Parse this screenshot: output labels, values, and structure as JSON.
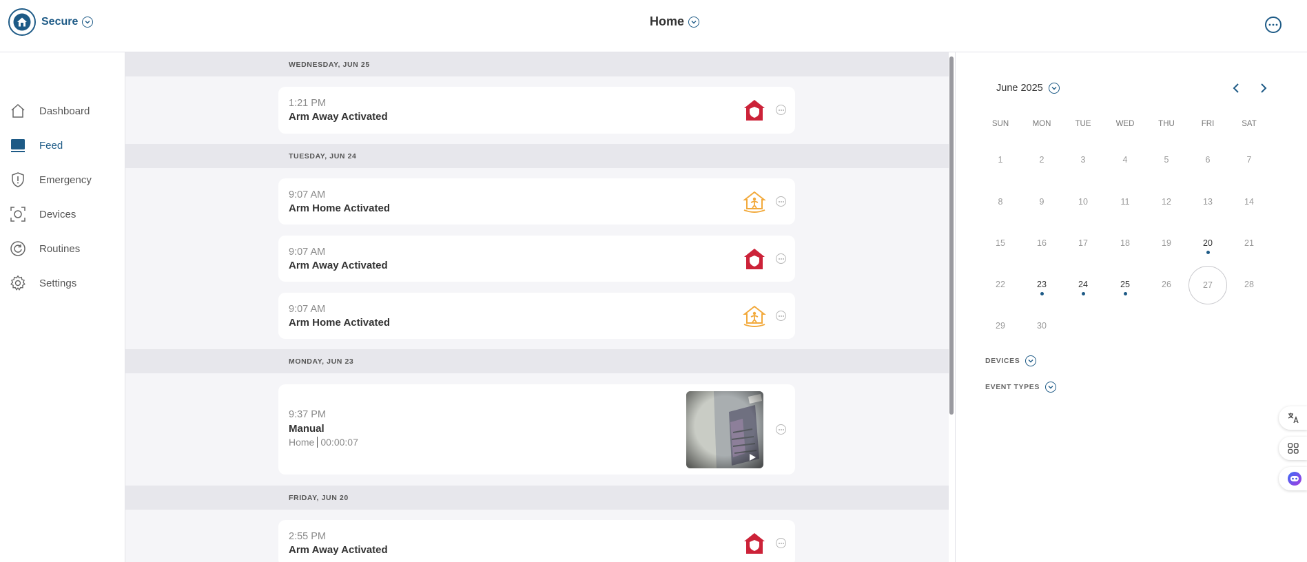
{
  "header": {
    "brand_label": "Secure",
    "title": "Home"
  },
  "sidebar": {
    "items": [
      {
        "label": "Dashboard",
        "icon": "home-outline-icon"
      },
      {
        "label": "Feed",
        "icon": "feed-icon"
      },
      {
        "label": "Emergency",
        "icon": "shield-alert-icon"
      },
      {
        "label": "Devices",
        "icon": "camera-device-icon"
      },
      {
        "label": "Routines",
        "icon": "routine-refresh-icon"
      },
      {
        "label": "Settings",
        "icon": "gear-icon"
      }
    ],
    "active": "Feed"
  },
  "feed": {
    "days": [
      {
        "header": "WEDNESDAY, JUN 25",
        "events": [
          {
            "time": "1:21 PM",
            "title": "Arm Away Activated",
            "icon": "arm-away-icon"
          }
        ]
      },
      {
        "header": "TUESDAY, JUN 24",
        "events": [
          {
            "time": "9:07 AM",
            "title": "Arm Home Activated",
            "icon": "arm-home-icon"
          },
          {
            "time": "9:07 AM",
            "title": "Arm Away Activated",
            "icon": "arm-away-icon"
          },
          {
            "time": "9:07 AM",
            "title": "Arm Home Activated",
            "icon": "arm-home-icon"
          }
        ]
      },
      {
        "header": "MONDAY, JUN 23",
        "events": [
          {
            "time": "9:37 PM",
            "title": "Manual",
            "location": "Home",
            "duration": "00:00:07",
            "icon": "video-thumbnail"
          }
        ]
      },
      {
        "header": "FRIDAY, JUN 20",
        "events": [
          {
            "time": "2:55 PM",
            "title": "Arm Away Activated",
            "icon": "arm-away-icon"
          }
        ]
      }
    ]
  },
  "calendar": {
    "month_label": "June 2025",
    "weekdays": [
      "SUN",
      "MON",
      "TUE",
      "WED",
      "THU",
      "FRI",
      "SAT"
    ],
    "weeks": [
      [
        "1",
        "2",
        "3",
        "4",
        "5",
        "6",
        "7"
      ],
      [
        "8",
        "9",
        "10",
        "11",
        "12",
        "13",
        "14"
      ],
      [
        "15",
        "16",
        "17",
        "18",
        "19",
        "20",
        "21"
      ],
      [
        "22",
        "23",
        "24",
        "25",
        "26",
        "27",
        "28"
      ],
      [
        "29",
        "30",
        "",
        "",
        "",
        "",
        ""
      ]
    ],
    "days_with_events": [
      "20",
      "23",
      "24",
      "25"
    ],
    "today": "27",
    "filters": {
      "devices_label": "DEVICES",
      "event_types_label": "EVENT TYPES"
    }
  },
  "colors": {
    "brand": "#1d5a86",
    "arm_away": "#cc2238",
    "arm_home": "#f2a93b",
    "day_header_bg": "#e7e7ec",
    "feed_bg": "#f5f5f8"
  },
  "floating_tools": [
    "translate-icon",
    "apps-grid-icon",
    "assistant-bot-icon"
  ]
}
